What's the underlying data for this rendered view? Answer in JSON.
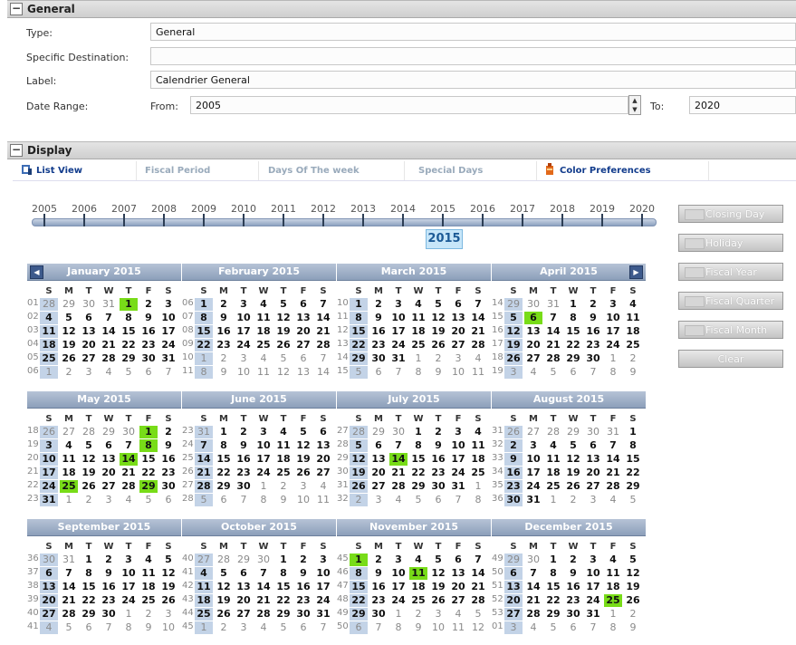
{
  "general": {
    "title": "General",
    "type_label": "Type:",
    "type_value": "General",
    "dest_label": "Specific Destination:",
    "dest_value": "",
    "name_label": "Label:",
    "name_value": "Calendrier General",
    "range_label": "Date Range:",
    "from_label": "From:",
    "from_value": "2005",
    "to_label": "To:",
    "to_value": "2020"
  },
  "display": {
    "title": "Display",
    "tabs": [
      "List View",
      "Fiscal Period",
      "Days Of The week",
      "Special Days",
      "Color Preferences"
    ]
  },
  "timeline": {
    "years": [
      "2005",
      "2006",
      "2007",
      "2008",
      "2009",
      "2010",
      "2011",
      "2012",
      "2013",
      "2014",
      "2015",
      "2016",
      "2017",
      "2018",
      "2019",
      "2020"
    ],
    "selected": "2015"
  },
  "side_buttons": [
    "Closing Day",
    "Holiday",
    "Fiscal Year",
    "Fiscal Quarter",
    "Fiscal Month",
    "Clear"
  ],
  "colors": {
    "highlight": "#78dc18",
    "weekday_shade": "#c3d3e7",
    "header": "#8c9fba"
  },
  "dow": [
    "S",
    "M",
    "T",
    "W",
    "T",
    "F",
    "S"
  ],
  "months": [
    {
      "title": "January 2015",
      "weeks": [
        "01",
        "02",
        "03",
        "04",
        "05",
        "06"
      ],
      "lead": [
        28,
        29,
        30,
        31
      ],
      "days": 31,
      "hl": [
        1
      ]
    },
    {
      "title": "February 2015",
      "weeks": [
        "06",
        "07",
        "08",
        "09",
        "10",
        "11"
      ],
      "lead": [],
      "days": 28,
      "hl": []
    },
    {
      "title": "March 2015",
      "weeks": [
        "10",
        "11",
        "12",
        "13",
        "14",
        "15"
      ],
      "lead": [],
      "days": 31,
      "hl": []
    },
    {
      "title": "April 2015",
      "weeks": [
        "14",
        "15",
        "16",
        "17",
        "18",
        "19"
      ],
      "lead": [
        29,
        30,
        31
      ],
      "days": 30,
      "hl": [
        6
      ]
    },
    {
      "title": "May 2015",
      "weeks": [
        "18",
        "19",
        "20",
        "21",
        "22",
        "23"
      ],
      "lead": [
        26,
        27,
        28,
        29,
        30
      ],
      "days": 31,
      "hl": [
        1,
        8,
        14,
        25,
        29
      ]
    },
    {
      "title": "June 2015",
      "weeks": [
        "23",
        "24",
        "25",
        "26",
        "27",
        "28"
      ],
      "lead": [
        31
      ],
      "days": 30,
      "hl": []
    },
    {
      "title": "July 2015",
      "weeks": [
        "27",
        "28",
        "29",
        "30",
        "31",
        "32"
      ],
      "lead": [
        28,
        29,
        30
      ],
      "days": 31,
      "hl": [
        14
      ]
    },
    {
      "title": "August 2015",
      "weeks": [
        "31",
        "32",
        "33",
        "34",
        "35",
        "36"
      ],
      "lead": [
        26,
        27,
        28,
        29,
        30,
        31
      ],
      "days": 31,
      "hl": []
    },
    {
      "title": "September 2015",
      "weeks": [
        "36",
        "37",
        "38",
        "39",
        "40",
        "41"
      ],
      "lead": [
        30,
        31
      ],
      "days": 30,
      "hl": []
    },
    {
      "title": "October 2015",
      "weeks": [
        "40",
        "41",
        "42",
        "43",
        "44",
        "45"
      ],
      "lead": [
        27,
        28,
        29,
        30
      ],
      "days": 31,
      "hl": []
    },
    {
      "title": "November 2015",
      "weeks": [
        "45",
        "46",
        "47",
        "48",
        "49",
        "50"
      ],
      "lead": [],
      "days": 30,
      "hl": [
        1,
        11
      ]
    },
    {
      "title": "December 2015",
      "weeks": [
        "49",
        "50",
        "51",
        "52",
        "53",
        "01"
      ],
      "lead": [
        29,
        30
      ],
      "days": 31,
      "hl": [
        25
      ]
    }
  ]
}
